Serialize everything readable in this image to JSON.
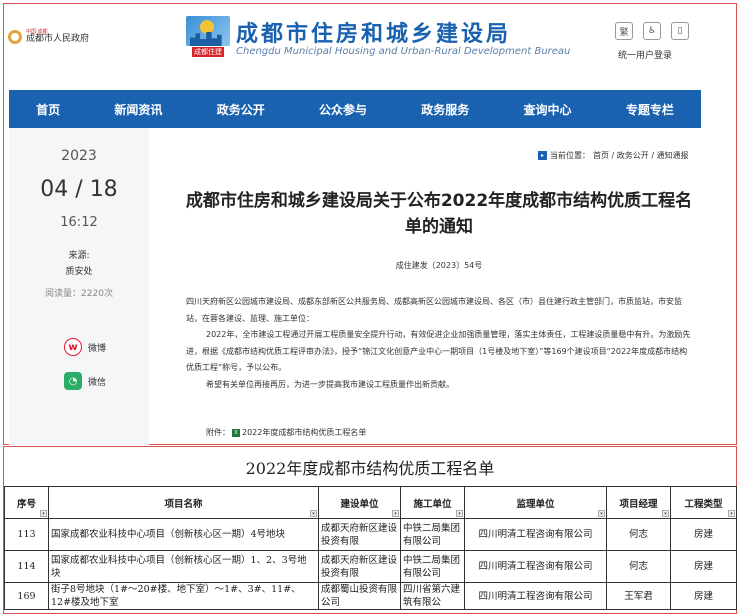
{
  "header": {
    "gov_small": "中国·成都",
    "gov_name": "成都市人民政府",
    "logo_tag": "成都住建",
    "site_title": "成都市住房和城乡建设局",
    "site_subtitle": "Chengdu Municipal Housing and Urban-Rural Development Bureau",
    "tools": [
      {
        "icon": "traditional-chinese-icon",
        "glyph": "繁"
      },
      {
        "icon": "accessibility-icon",
        "glyph": "♿"
      },
      {
        "icon": "mobile-icon",
        "glyph": "▯"
      }
    ],
    "login": "统一用户登录"
  },
  "nav": {
    "items": [
      "首页",
      "新闻资讯",
      "政务公开",
      "公众参与",
      "政务服务",
      "查询中心",
      "专题专栏"
    ]
  },
  "info": {
    "year": "2023",
    "month_day": "04 / 18",
    "time": "16:12",
    "source_label": "来源:",
    "source_value": "质安处",
    "read_count": "阅读量：2220次",
    "share_weibo": "微博",
    "share_wechat": "微信"
  },
  "breadcrumb": {
    "label": "当前位置：",
    "path": "首页 / 政务公开 / 通知通报"
  },
  "article": {
    "title": "成都市住房和城乡建设局关于公布2022年度成都市结构优质工程名单的通知",
    "doc_number": "成住建发〔2023〕54号",
    "p1": "四川天府新区公园城市建设局、成都东部新区公共服务局、成都高新区公园城市建设局、各区（市）县住建行政主管部门，市质监站，市安监站，在蓉各建设、监理、施工单位：",
    "p2": "2022年，全市建设工程通过开展工程质量安全提升行动，有效促进企业加强质量管理，落实主体责任，工程建设质量稳中有升。为激励先进，根据《成都市结构优质工程评审办法》，授予“锦江文化创意产业中心一期项目（1号楼及地下室）”等169个建设项目“2022年度成都市结构优质工程”称号，予以公布。",
    "p3": "希望有关单位再接再厉，为进一步提高我市建设工程质量作出新贡献。",
    "attachment_label": "附件：",
    "attachment_name": "2022年度成都市结构优质工程名单"
  },
  "sheet": {
    "title": "2022年度成都市结构优质工程名单",
    "headers": [
      "序号",
      "项目名称",
      "建设单位",
      "施工单位",
      "监理单位",
      "项目经理",
      "工程类型"
    ],
    "rows": [
      [
        "113",
        "国家成都农业科技中心项目（创新核心区一期）4号地块",
        "成都天府新区建设投资有限",
        "中铁二局集团有限公司",
        "四川明清工程咨询有限公司",
        "何志",
        "房建"
      ],
      [
        "114",
        "国家成都农业科技中心项目（创新核心区一期）1、2、3号地块",
        "成都天府新区建设投资有限",
        "中铁二局集团有限公司",
        "四川明清工程咨询有限公司",
        "何志",
        "房建"
      ],
      [
        "169",
        "街子8号地块（1#～20#楼、地下室）～1#、3#、11#、12#楼及地下室",
        "成都蜀山投资有限公司",
        "四川省第六建筑有限公",
        "四川明清工程咨询有限公司",
        "王军君",
        "房建"
      ]
    ]
  }
}
